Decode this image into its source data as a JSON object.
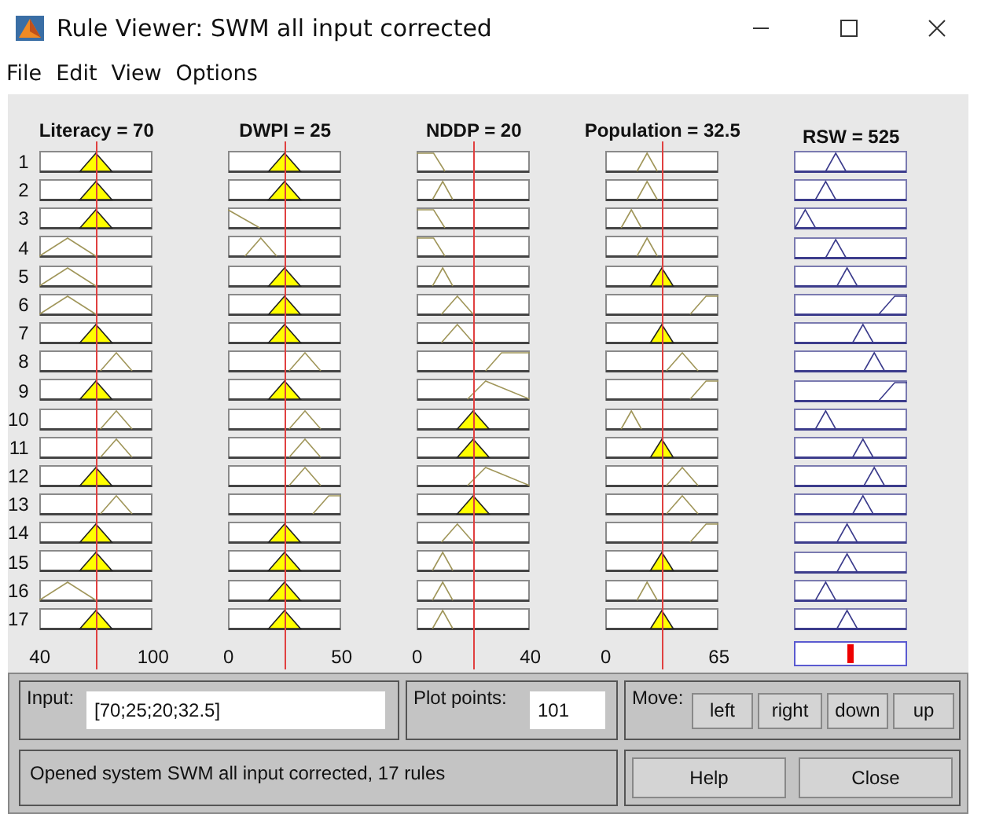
{
  "window": {
    "title": "Rule Viewer: SWM all input corrected"
  },
  "menu": [
    "File",
    "Edit",
    "View",
    "Options"
  ],
  "rules": [
    "1",
    "2",
    "3",
    "4",
    "5",
    "6",
    "7",
    "8",
    "9",
    "10",
    "11",
    "12",
    "13",
    "14",
    "15",
    "16",
    "17"
  ],
  "variables": [
    {
      "kind": "input",
      "title": "Literacy = 70",
      "range": [
        "40",
        "100"
      ],
      "mfs": [
        {
          "kind": "fired"
        },
        {
          "kind": "fired"
        },
        {
          "kind": "fired"
        },
        {
          "kind": "wide_low"
        },
        {
          "kind": "wide_low"
        },
        {
          "kind": "wide_low"
        },
        {
          "kind": "fired"
        },
        {
          "kind": "tri_high"
        },
        {
          "kind": "fired"
        },
        {
          "kind": "tri_high"
        },
        {
          "kind": "tri_high"
        },
        {
          "kind": "fired"
        },
        {
          "kind": "tri_high"
        },
        {
          "kind": "fired"
        },
        {
          "kind": "fired"
        },
        {
          "kind": "wide_low"
        },
        {
          "kind": "fired"
        }
      ]
    },
    {
      "kind": "input",
      "title": "DWPI = 25",
      "range": [
        "0",
        "50"
      ],
      "mfs": [
        {
          "kind": "fired"
        },
        {
          "kind": "fired"
        },
        {
          "kind": "ramp_down"
        },
        {
          "kind": "tri_low"
        },
        {
          "kind": "fired"
        },
        {
          "kind": "fired"
        },
        {
          "kind": "fired"
        },
        {
          "kind": "tri_high"
        },
        {
          "kind": "fired"
        },
        {
          "kind": "tri_high"
        },
        {
          "kind": "tri_high"
        },
        {
          "kind": "tri_high"
        },
        {
          "kind": "ramp_up_high"
        },
        {
          "kind": "fired"
        },
        {
          "kind": "fired"
        },
        {
          "kind": "fired"
        },
        {
          "kind": "fired"
        }
      ]
    },
    {
      "kind": "input",
      "title": "NDDP = 20",
      "range": [
        "0",
        "40"
      ],
      "mfs": [
        {
          "kind": "shoulder_left"
        },
        {
          "kind": "narrow_low"
        },
        {
          "kind": "shoulder_left"
        },
        {
          "kind": "shoulder_left"
        },
        {
          "kind": "narrow_low"
        },
        {
          "kind": "tri_mid_low"
        },
        {
          "kind": "tri_mid_low"
        },
        {
          "kind": "ramp_up_mid"
        },
        {
          "kind": "skew_mid"
        },
        {
          "kind": "fired"
        },
        {
          "kind": "fired"
        },
        {
          "kind": "skew_mid"
        },
        {
          "kind": "fired"
        },
        {
          "kind": "tri_mid_low"
        },
        {
          "kind": "narrow_low"
        },
        {
          "kind": "narrow_low"
        },
        {
          "kind": "narrow_low"
        }
      ]
    },
    {
      "kind": "input",
      "title": "Population = 32.5",
      "range": [
        "0",
        "65"
      ],
      "mfs": [
        {
          "kind": "narrow_mid_low"
        },
        {
          "kind": "narrow_mid_low"
        },
        {
          "kind": "narrow_low"
        },
        {
          "kind": "narrow_mid_low"
        },
        {
          "kind": "fired_narrow"
        },
        {
          "kind": "ramp_up_high"
        },
        {
          "kind": "fired_narrow"
        },
        {
          "kind": "tri_high"
        },
        {
          "kind": "ramp_up_high"
        },
        {
          "kind": "narrow_low"
        },
        {
          "kind": "fired_narrow"
        },
        {
          "kind": "tri_high"
        },
        {
          "kind": "tri_high"
        },
        {
          "kind": "ramp_up_high"
        },
        {
          "kind": "fired_narrow"
        },
        {
          "kind": "narrow_mid_low"
        },
        {
          "kind": "fired_narrow"
        }
      ]
    },
    {
      "kind": "output",
      "title": "RSW = 525",
      "mfs": [
        {
          "kind": "narrow_mid_low"
        },
        {
          "kind": "narrow_low_mid"
        },
        {
          "kind": "narrow_far_low"
        },
        {
          "kind": "narrow_mid_low"
        },
        {
          "kind": "narrow_mid"
        },
        {
          "kind": "ramp_up_high"
        },
        {
          "kind": "narrow_mid_high"
        },
        {
          "kind": "narrow_high"
        },
        {
          "kind": "ramp_up_high"
        },
        {
          "kind": "narrow_low_mid"
        },
        {
          "kind": "narrow_mid_high"
        },
        {
          "kind": "narrow_high"
        },
        {
          "kind": "narrow_mid_high"
        },
        {
          "kind": "narrow_mid"
        },
        {
          "kind": "narrow_mid"
        },
        {
          "kind": "narrow_low_mid"
        },
        {
          "kind": "narrow_mid"
        }
      ]
    }
  ],
  "input": {
    "label": "Input:",
    "value": "[70;25;20;32.5]"
  },
  "plot_points": {
    "label": "Plot points:",
    "value": "101"
  },
  "move": {
    "label": "Move:",
    "buttons": [
      "left",
      "right",
      "down",
      "up"
    ]
  },
  "status": "Opened system SWM all input corrected, 17 rules",
  "buttons": [
    "Help",
    "Close"
  ]
}
